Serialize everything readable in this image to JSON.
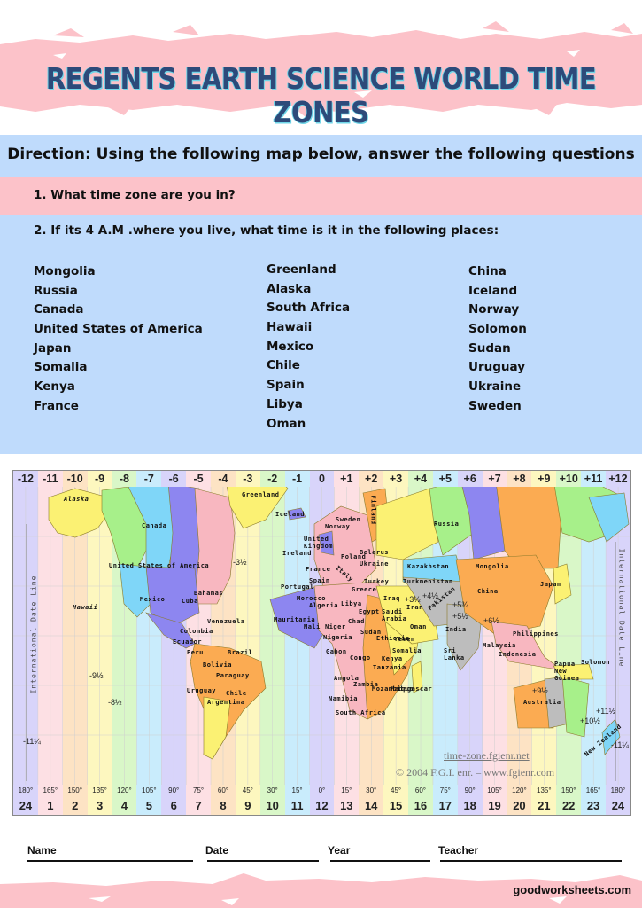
{
  "header": {
    "title": "REGENTS EARTH SCIENCE WORLD TIME ZONES",
    "brush_color": "#fcc2c9",
    "title_color": "#2d4a7a"
  },
  "instructions": {
    "direction": "Direction: Using the following map below, answer the following questions",
    "question_1": "1. What time zone are you in?",
    "question_2": "2.  If its 4 A.M .where you live, what time is it in the following places:",
    "panel_color": "#bfdbfc",
    "highlight_color": "#fcc2c9"
  },
  "places": {
    "column_1": [
      "Mongolia",
      "Russia",
      "Canada",
      "United States of America",
      "Japan",
      "Somalia",
      "Kenya",
      "France"
    ],
    "column_2": [
      "Greenland",
      "Alaska",
      "South Africa",
      "Hawaii",
      "Mexico",
      "Chile",
      "Spain",
      "Libya",
      "Oman"
    ],
    "column_3": [
      "China",
      "Iceland",
      "Norway",
      "Solomon",
      "Sudan",
      "Uruguay",
      "Ukraine",
      "Sweden"
    ]
  },
  "map": {
    "zone_offsets": [
      "-12",
      "-11",
      "-10",
      "-9",
      "-8",
      "-7",
      "-6",
      "-5",
      "-4",
      "-3",
      "-2",
      "-1",
      "0",
      "+1",
      "+2",
      "+3",
      "+4",
      "+5",
      "+6",
      "+7",
      "+8",
      "+9",
      "+10",
      "+11",
      "+12"
    ],
    "longitudes": [
      "180°",
      "165°",
      "150°",
      "135°",
      "120°",
      "105°",
      "90°",
      "75°",
      "60°",
      "45°",
      "30°",
      "15°",
      "0°",
      "15°",
      "30°",
      "45°",
      "60°",
      "75°",
      "90°",
      "105°",
      "120°",
      "135°",
      "150°",
      "165°",
      "180°"
    ],
    "hours": [
      "24",
      "1",
      "2",
      "3",
      "4",
      "5",
      "6",
      "7",
      "8",
      "9",
      "10",
      "11",
      "12",
      "13",
      "14",
      "15",
      "16",
      "17",
      "18",
      "19",
      "20",
      "21",
      "22",
      "23",
      "24"
    ],
    "zone_colors": [
      "#d8d4fa",
      "#fde0e4",
      "#fde3c4",
      "#fdf7bf",
      "#d9f7c8",
      "#c9ecfc",
      "#d8d4fa",
      "#fde0e4",
      "#fde3c4",
      "#fdf7bf",
      "#d9f7c8",
      "#c9ecfc",
      "#d8d4fa",
      "#fde0e4",
      "#fde3c4",
      "#fdf7bf",
      "#d9f7c8",
      "#c9ecfc",
      "#d8d4fa",
      "#fde0e4",
      "#fde3c4",
      "#fdf7bf",
      "#d9f7c8",
      "#c9ecfc",
      "#d8d4fa"
    ],
    "international_date_line": "International Date Line",
    "country_labels": [
      "Alaska",
      "Canada",
      "United States of America",
      "Mexico",
      "Cuba",
      "Bahamas",
      "Hawaii",
      "Greenland",
      "Iceland",
      "Sweden",
      "Norway",
      "Finland",
      "United Kingdom",
      "Ireland",
      "Poland",
      "Belarus",
      "Ukraine",
      "France",
      "Italy",
      "Spain",
      "Portugal",
      "Turkey",
      "Greece",
      "Morocco",
      "Algeria",
      "Libya",
      "Egypt",
      "Mauritania",
      "Mali",
      "Niger",
      "Chad",
      "Nigeria",
      "Sudan",
      "Gabon",
      "Congo",
      "Ethiopia",
      "Somalia",
      "Kenya",
      "Tanzania",
      "Angola",
      "Zambia",
      "Namibia",
      "Mozambique",
      "Madagascar",
      "South Africa",
      "Saudi Arabia",
      "Yemen",
      "Oman",
      "Iraq",
      "Iran",
      "Turkmenistan",
      "Kazakhstan",
      "Pakistan",
      "India",
      "Sri Lanka",
      "Russia",
      "Mongolia",
      "China",
      "Japan",
      "Philippines",
      "Malaysia",
      "Indonesia",
      "Papua New Guinea",
      "Solomon",
      "Australia",
      "New Zealand",
      "Venezuela",
      "Colombia",
      "Ecuador",
      "Peru",
      "Brazil",
      "Bolivia",
      "Paraguay",
      "Chile",
      "Uruguay",
      "Argentina"
    ],
    "fractional_offsets": [
      "-3½",
      "-9½",
      "-8½",
      "-11¼",
      "+3½",
      "+4½",
      "+5½",
      "+5¾",
      "+6½",
      "+9½",
      "+10½",
      "+11½",
      "-11¼"
    ],
    "credit_site": "time-zone.fgienr.net",
    "credit_copyright": "© 2004  F.G.I. enr. – www.fgienr.com"
  },
  "form": {
    "name_label": "Name",
    "date_label": "Date",
    "year_label": "Year",
    "teacher_label": "Teacher"
  },
  "footer": {
    "brand": "goodworksheets.com"
  }
}
